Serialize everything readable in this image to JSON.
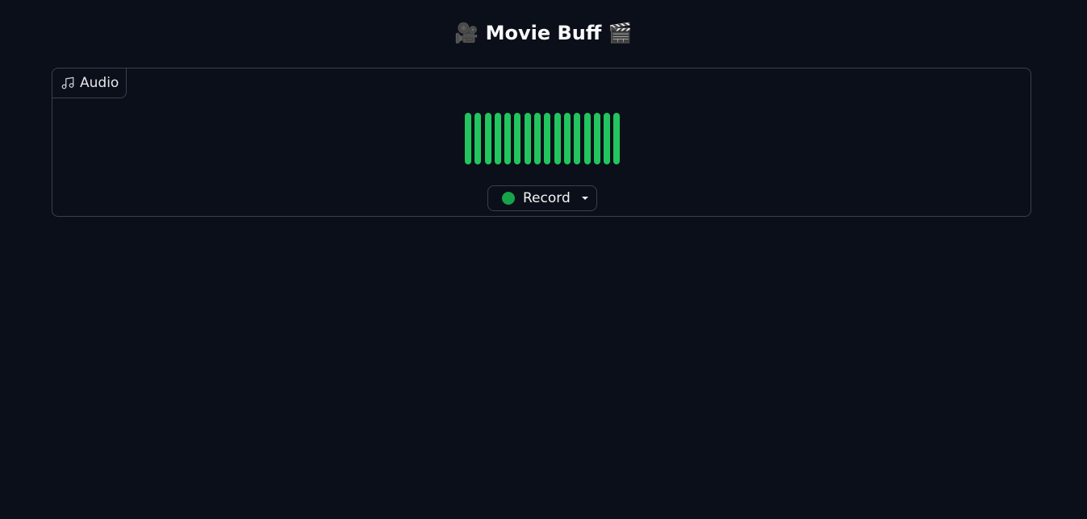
{
  "app": {
    "title_text": "Movie Buff",
    "title_emoji_left": "🎥",
    "title_emoji_right": "🎬"
  },
  "audio_panel": {
    "label": "Audio",
    "label_icon": "music-note-icon",
    "waveform": {
      "bar_count": 16,
      "color": "#22c55e"
    },
    "record_button": {
      "label": "Record",
      "dot_color": "#16a34a",
      "dropdown_icon": "caret-down-icon"
    }
  },
  "colors": {
    "background": "#0b0f19",
    "border": "#374151",
    "text": "#f3f4f6"
  }
}
